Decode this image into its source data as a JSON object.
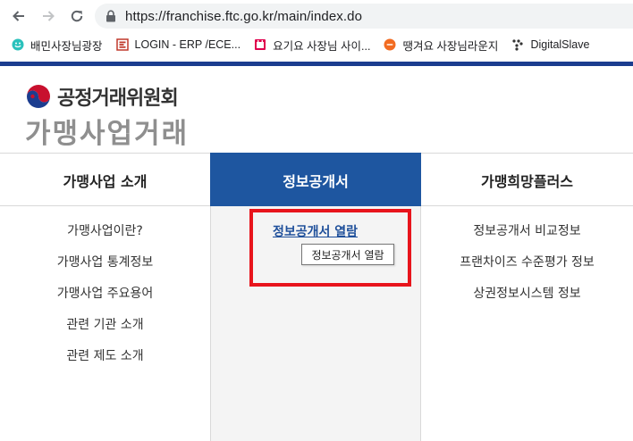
{
  "browser": {
    "url": "https://franchise.ftc.go.kr/main/index.do",
    "bookmarks": [
      {
        "label": "배민사장님광장",
        "icon": "baemin-icon",
        "color": "#2ac1bc"
      },
      {
        "label": "LOGIN - ERP /ECE...",
        "icon": "erp-icon",
        "color": "#c0392b"
      },
      {
        "label": "요기요 사장님 사이...",
        "icon": "yogiyo-icon",
        "color": "#e0004d"
      },
      {
        "label": "땡겨요 사장님라운지",
        "icon": "ddangyo-icon",
        "color": "#f26b21"
      },
      {
        "label": "DigitalSlave",
        "icon": "digitalslave-icon",
        "color": "#333333"
      }
    ]
  },
  "header": {
    "org_name": "공정거래위원회",
    "site_title": "가맹사업거래"
  },
  "menu": {
    "columns": [
      {
        "title": "가맹사업 소개",
        "items": [
          "가맹사업이란?",
          "가맹사업 통계정보",
          "가맹사업 주요용어",
          "관련 기관 소개",
          "관련 제도 소개"
        ]
      },
      {
        "title": "정보공개서",
        "items": [
          "정보공개서 열람"
        ],
        "active": true
      },
      {
        "title": "가맹희망플러스",
        "items": [
          "정보공개서 비교정보",
          "프랜차이즈 수준평가 정보",
          "상권정보시스템 정보"
        ]
      }
    ],
    "tooltip": "정보공개서 열람"
  },
  "colors": {
    "brand_blue": "#1e56a0",
    "top_bar": "#1b3d8f",
    "highlight_red": "#e8141c",
    "link": "#1e4f9a"
  }
}
